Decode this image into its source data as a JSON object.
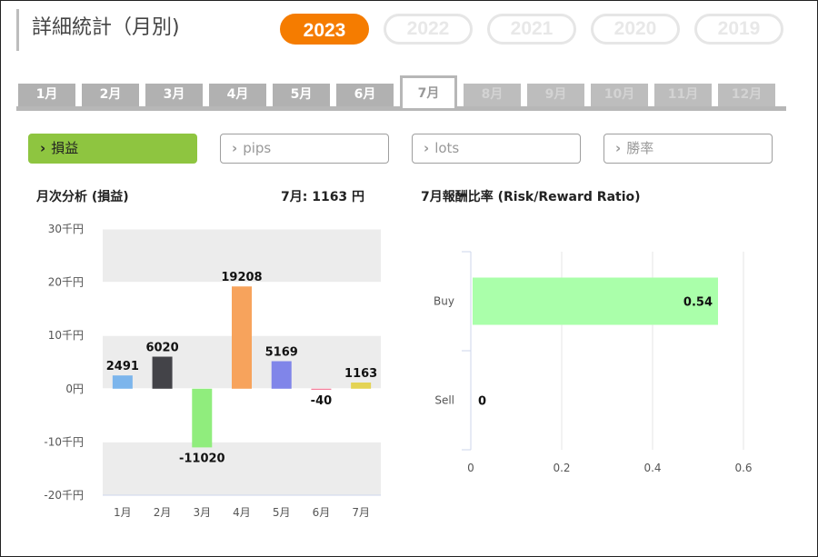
{
  "header": {
    "title": "詳細統計（月別)"
  },
  "years": [
    {
      "label": "2023",
      "active": true
    },
    {
      "label": "2022",
      "active": false
    },
    {
      "label": "2021",
      "active": false
    },
    {
      "label": "2020",
      "active": false
    },
    {
      "label": "2019",
      "active": false
    }
  ],
  "months": [
    "1月",
    "2月",
    "3月",
    "4月",
    "5月",
    "6月",
    "7月",
    "8月",
    "9月",
    "10月",
    "11月",
    "12月"
  ],
  "active_month_index": 6,
  "categories": [
    {
      "label": "損益",
      "active": true
    },
    {
      "label": "pips",
      "active": false
    },
    {
      "label": "lots",
      "active": false
    },
    {
      "label": "勝率",
      "active": false
    }
  ],
  "left_chart": {
    "title": "月次分析 (損益)",
    "summary": "7月:  1163 円"
  },
  "right_chart": {
    "title": "7月報酬比率 (Risk/Reward Ratio)"
  },
  "chart_data": [
    {
      "type": "bar",
      "categories": [
        "1月",
        "2月",
        "3月",
        "4月",
        "5月",
        "6月",
        "7月"
      ],
      "values": [
        2491,
        6020,
        -11020,
        19208,
        5169,
        -40,
        1163
      ],
      "data_labels": [
        "2491",
        "6020",
        "-11020",
        "19208",
        "5169",
        "-40",
        "1163"
      ],
      "colors": [
        "#7cb5ec",
        "#434348",
        "#90ed7d",
        "#f7a35c",
        "#8085e9",
        "#f15c80",
        "#e4d354"
      ],
      "ylim": [
        -20000,
        30000
      ],
      "yticks": [
        "30千円",
        "20千円",
        "10千円",
        "0円",
        "-10千円",
        "-20千円"
      ],
      "ytick_values": [
        30000,
        20000,
        10000,
        0,
        -10000,
        -20000
      ],
      "grid": "banded"
    },
    {
      "type": "bar",
      "orientation": "horizontal",
      "categories": [
        "Buy",
        "Sell"
      ],
      "values": [
        0.54,
        0
      ],
      "data_labels": [
        "0.54",
        "0"
      ],
      "color": "#aaffaa",
      "xlim": [
        0,
        0.6
      ],
      "xticks": [
        "0",
        "0.2",
        "0.4",
        "0.6"
      ],
      "xtick_values": [
        0,
        0.2,
        0.4,
        0.6
      ]
    }
  ]
}
